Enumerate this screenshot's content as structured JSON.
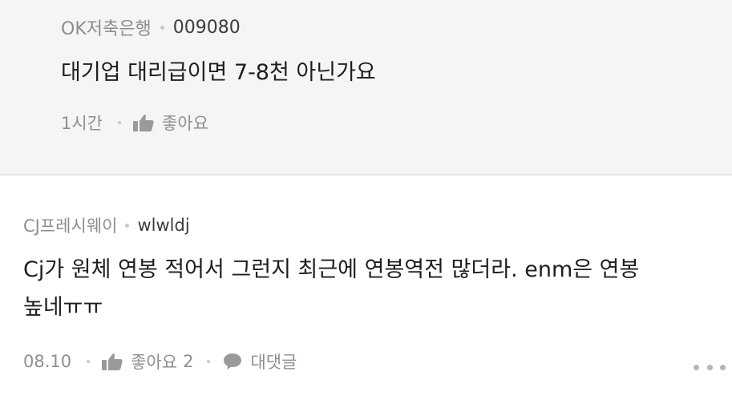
{
  "reply": {
    "company": "OK저축은행",
    "nickname": "009080",
    "text": "대기업 대리급이면 7-8천 아닌가요",
    "time": "1시간",
    "like_label": "좋아요"
  },
  "comment": {
    "company": "CJ프레시웨이",
    "nickname": "wlwldj",
    "text_line1": "Cj가 원체 연봉 적어서 그런지 최근에 연봉역전 많더라. enm은 연봉",
    "text_line2": "높네ㅠㅠ",
    "date": "08.10",
    "like_label": "좋아요",
    "like_count": "2",
    "reply_label": "대댓글"
  },
  "icons": {
    "like": "thumbs-up-icon",
    "reply": "speech-bubble-icon",
    "more": "more-dots-icon"
  },
  "colors": {
    "reply_background": "#f5f5f5",
    "meta_gray": "#8f8f8f"
  }
}
